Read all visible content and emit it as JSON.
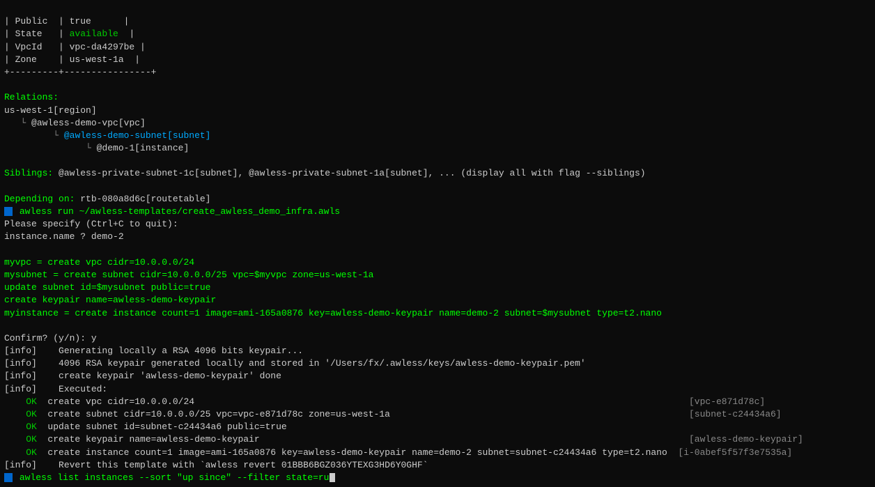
{
  "terminal": {
    "lines": [
      {
        "type": "plain",
        "text": "| Public  | true      |"
      },
      {
        "type": "state",
        "text": "| State   | available |"
      },
      {
        "type": "plain",
        "text": "| VpcId   | vpc-da4297be |"
      },
      {
        "type": "plain",
        "text": "| Zone    | us-west-1a  |"
      },
      {
        "type": "separator",
        "text": "+----------+-------------------+"
      },
      {
        "type": "blank"
      },
      {
        "type": "relations_header",
        "text": "Relations:"
      },
      {
        "type": "plain",
        "text": "us-west-1[region]"
      },
      {
        "type": "indent1_vpc",
        "text": "  └ @awless-demo-vpc[vpc]"
      },
      {
        "type": "indent2_subnet",
        "text": "      └ @awless-demo-subnet[subnet]"
      },
      {
        "type": "indent3_instance",
        "text": "          └ @demo-1[instance]"
      },
      {
        "type": "blank"
      },
      {
        "type": "siblings",
        "text": "Siblings: @awless-private-subnet-1c[subnet], @awless-private-subnet-1a[subnet], ... (display all with flag --siblings)"
      },
      {
        "type": "blank"
      },
      {
        "type": "depending",
        "text": "Depending on: rtb-080a8d6c[routetable]"
      },
      {
        "type": "prompt_cmd",
        "text": "awless run ~/awless-templates/create_awless_demo_infra.awls"
      },
      {
        "type": "plain",
        "text": "Please specify (Ctrl+C to quit):"
      },
      {
        "type": "input_line",
        "text": "instance.name ? demo-2"
      },
      {
        "type": "blank"
      },
      {
        "type": "myvpc",
        "text": "myvpc = create vpc cidr=10.0.0.0/24"
      },
      {
        "type": "mysubnet",
        "text": "mysubnet = create subnet cidr=10.0.0.0/25 vpc=$myvpc zone=us-west-1a"
      },
      {
        "type": "myvpc",
        "text": "update subnet id=$mysubnet public=true"
      },
      {
        "type": "myvpc",
        "text": "create keypair name=awless-demo-keypair"
      },
      {
        "type": "myinstance",
        "text": "myinstance = create instance count=1 image=ami-165a0876 key=awless-demo-keypair name=demo-2 subnet=$mysubnet type=t2.nano"
      },
      {
        "type": "blank"
      },
      {
        "type": "confirm",
        "text": "Confirm? (y/n): y"
      },
      {
        "type": "info",
        "text": "[info]    Generating locally a RSA 4096 bits keypair..."
      },
      {
        "type": "info",
        "text": "[info]    4096 RSA keypair generated locally and stored in '/Users/fx/.awless/keys/awless-demo-keypair.pem'"
      },
      {
        "type": "info",
        "text": "[info]    create keypair 'awless-demo-keypair' done"
      },
      {
        "type": "info",
        "text": "[info]    Executed:"
      },
      {
        "type": "ok_vpc",
        "text": "    OK  create vpc cidr=10.0.0.0/24",
        "result": "[vpc-e871d78c]"
      },
      {
        "type": "ok_subnet",
        "text": "    OK  create subnet cidr=10.0.0.0/25 vpc=vpc-e871d78c zone=us-west-1a",
        "result": "[subnet-c24434a6]"
      },
      {
        "type": "ok_plain",
        "text": "    OK  update subnet id=subnet-c24434a6 public=true"
      },
      {
        "type": "ok_keypair",
        "text": "    OK  create keypair name=awless-demo-keypair",
        "result": "[awless-demo-keypair]"
      },
      {
        "type": "ok_instance",
        "text": "    OK  create instance count=1 image=ami-165a0876 key=awless-demo-keypair name=demo-2 subnet=subnet-c24434a6 type=t2.nano",
        "result": "[i-0abef5f57f3e7535a]"
      },
      {
        "type": "info_revert",
        "text": "[info]    Revert this template with `awless revert 01BBB6BGZ036YTEXG3HD6Y0GHF`"
      },
      {
        "type": "prompt_last",
        "text": "awless list instances --sort \"up since\" --filter state=ru"
      }
    ]
  }
}
